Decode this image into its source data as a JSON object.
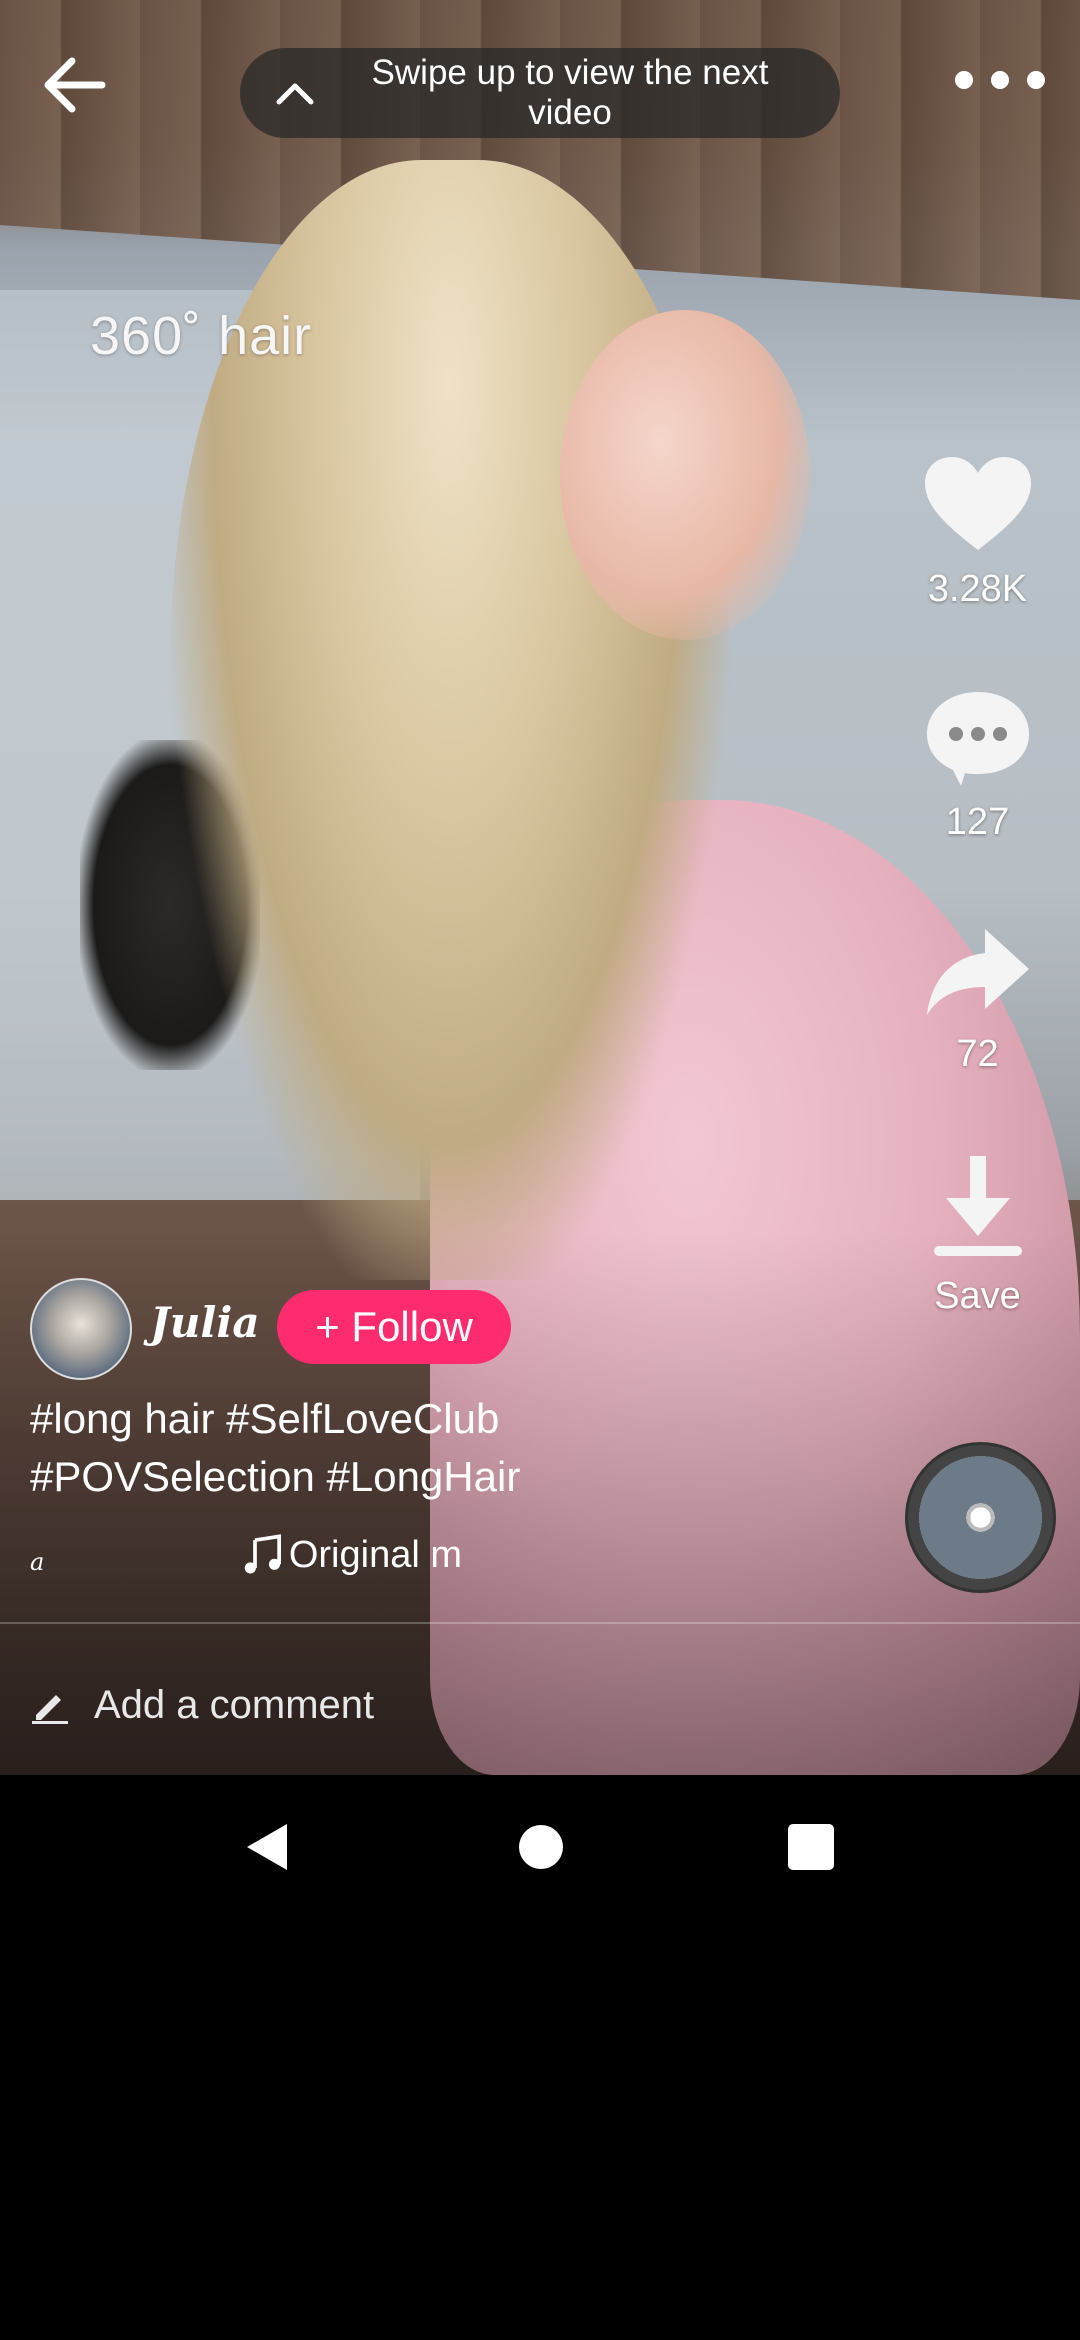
{
  "top": {
    "swipe_hint": "Swipe up to view the next video"
  },
  "video": {
    "overlay_caption": "360˚ hair"
  },
  "actions": {
    "likes": "3.28K",
    "comments": "127",
    "shares": "72",
    "save_label": "Save"
  },
  "author": {
    "name": "Julia",
    "follow_label": "+ Follow"
  },
  "description": {
    "hashtags_line1": "#long hair  #SelfLoveClub",
    "hashtags_line2": "#POVSelection #LongHair"
  },
  "music": {
    "left_text": "a",
    "title": "Original m"
  },
  "comment": {
    "placeholder": "Add a comment"
  },
  "colors": {
    "follow_button": "#fe2c6f"
  }
}
